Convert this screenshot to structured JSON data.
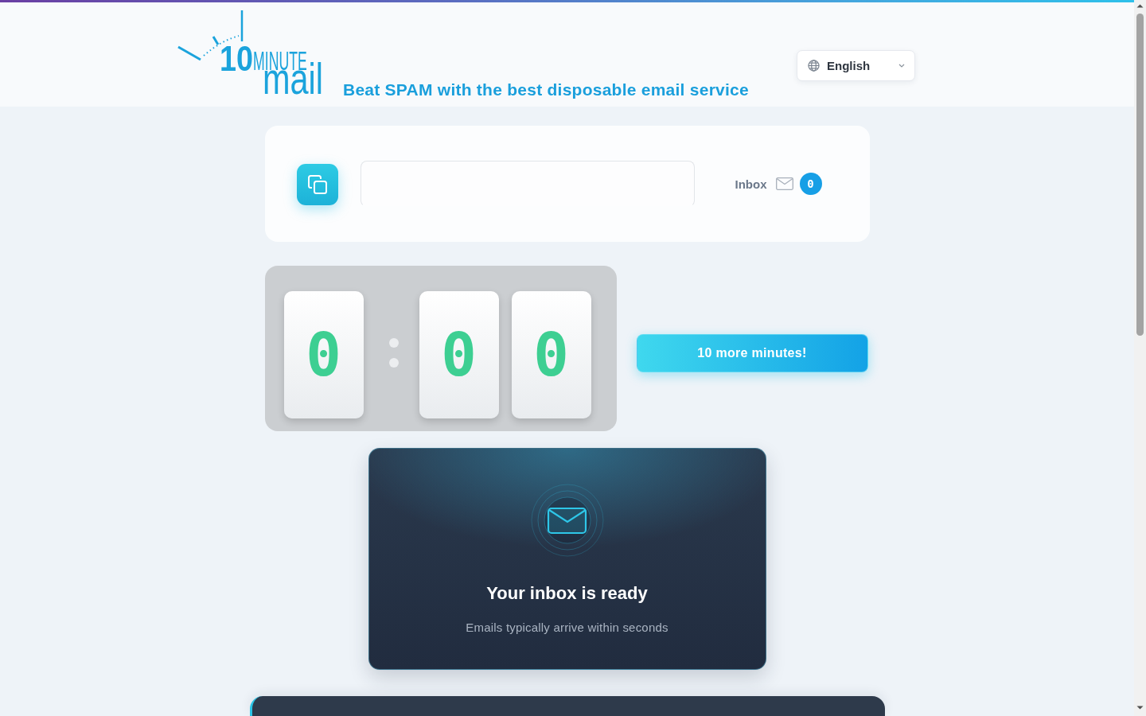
{
  "header": {
    "logo": {
      "number": "10",
      "word": "MINUTE",
      "brand": "mail"
    },
    "tagline": "Beat SPAM with the best disposable email service",
    "language": {
      "value": "English"
    }
  },
  "address_card": {
    "inbox": {
      "label": "Inbox",
      "count": "0"
    }
  },
  "timer": {
    "minutes": [
      "0"
    ],
    "seconds": [
      "0",
      "0"
    ]
  },
  "extend_button": {
    "label": "10 more minutes!"
  },
  "inbox_panel": {
    "title": "Your inbox is ready",
    "subtitle": "Emails typically arrive within seconds"
  }
}
